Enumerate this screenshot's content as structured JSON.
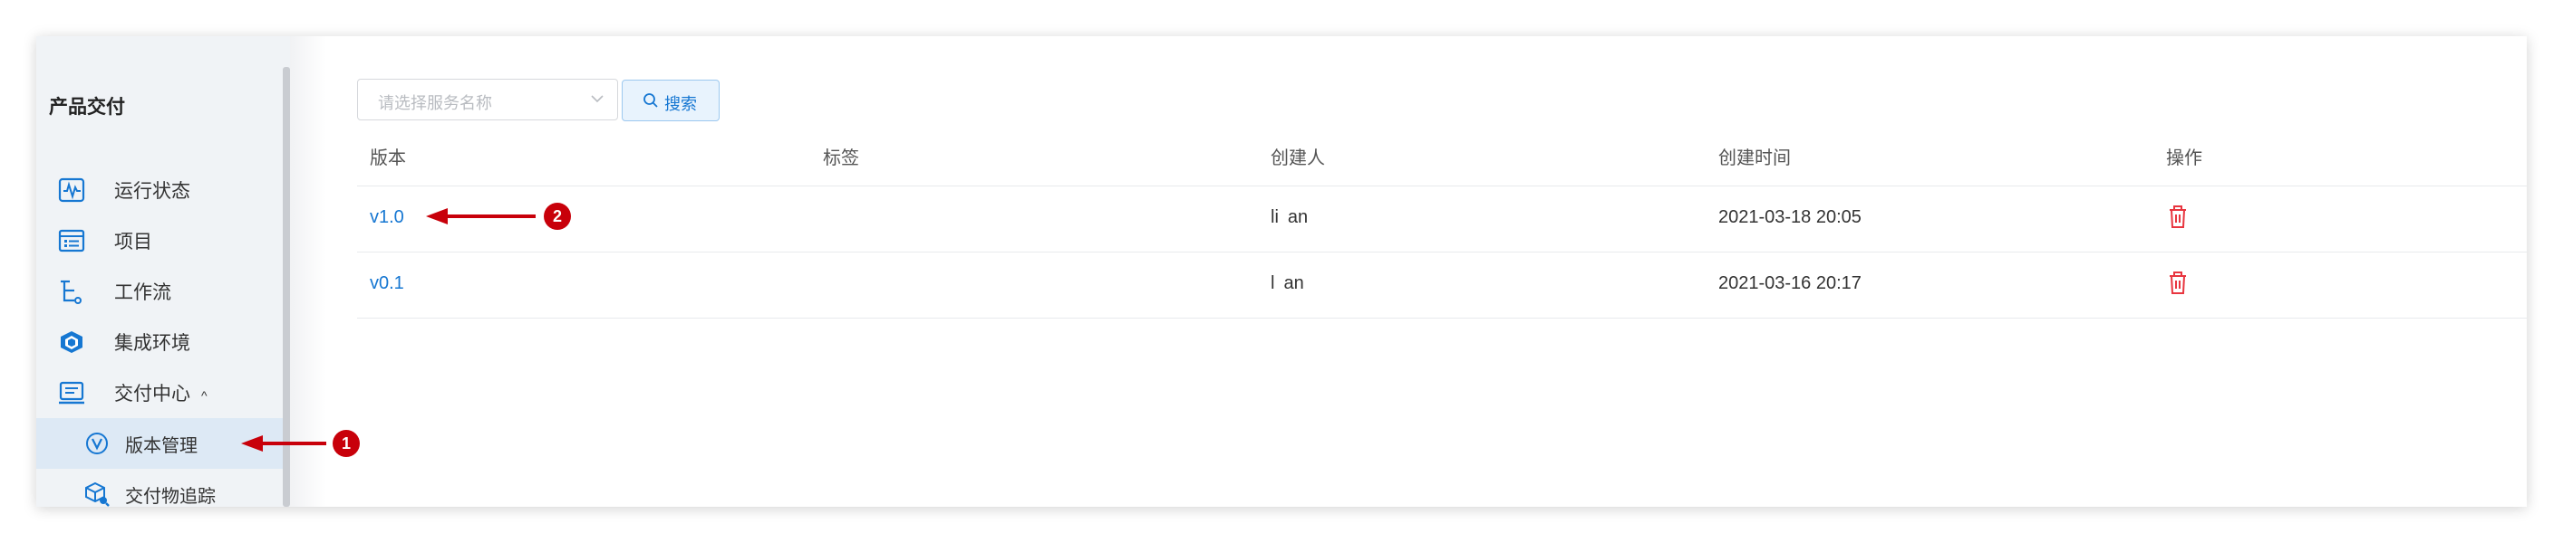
{
  "sidebar": {
    "section_title": "产品交付",
    "items": [
      {
        "label": "运行状态",
        "icon": "activity-chart-icon"
      },
      {
        "label": "项目",
        "icon": "project-list-icon"
      },
      {
        "label": "工作流",
        "icon": "workflow-tree-icon"
      },
      {
        "label": "集成环境",
        "icon": "integration-cube-icon"
      },
      {
        "label": "交付中心",
        "icon": "delivery-center-icon",
        "caret": "^"
      }
    ],
    "sub_items": [
      {
        "label": "版本管理",
        "icon": "version-v-icon",
        "active": true
      },
      {
        "label": "交付物追踪",
        "icon": "package-search-icon"
      }
    ]
  },
  "toolbar": {
    "select_placeholder": "请选择服务名称",
    "search_label": "搜索"
  },
  "table": {
    "columns": [
      "版本",
      "标签",
      "创建人",
      "创建时间",
      "操作"
    ],
    "rows": [
      {
        "version": "v1.0",
        "tag": "",
        "creator": "li an",
        "created": "2021-03-18 20:05"
      },
      {
        "version": "v0.1",
        "tag": "",
        "creator": "l an",
        "created": "2021-03-16 20:17"
      }
    ]
  },
  "annotations": [
    {
      "number": "1",
      "target": "版本管理"
    },
    {
      "number": "2",
      "target": "v1.0"
    }
  ],
  "colors": {
    "accent": "#1677d2",
    "danger": "#e8353f",
    "annotation": "#c8000a",
    "sidebar_bg": "#f0f3f6",
    "active_bg": "#dde9f5"
  }
}
